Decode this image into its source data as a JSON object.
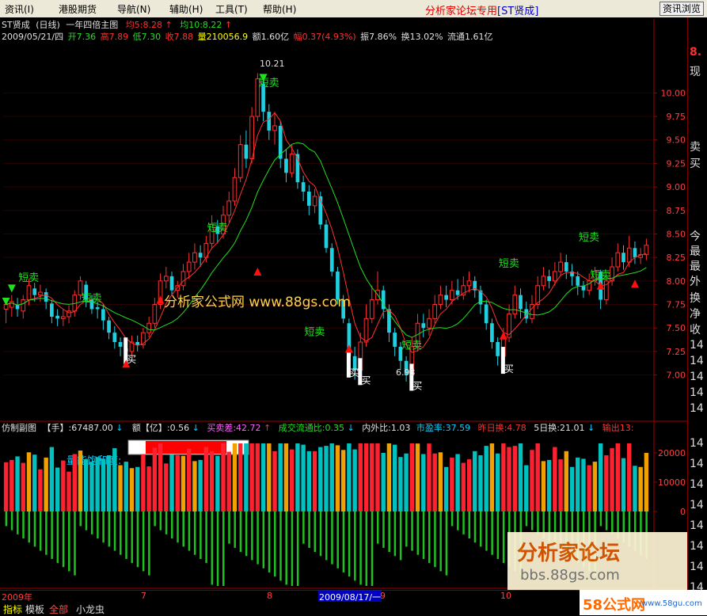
{
  "menubar": {
    "items": [
      "资讯(I)",
      "港股期货",
      "导航(N)",
      "辅助(H)",
      "工具(T)",
      "帮助(H)"
    ],
    "title": "分析家论坛专用",
    "title_stock": "[ST贤成]",
    "info_button": "资讯浏览"
  },
  "main_chart": {
    "header1": {
      "stock": "ST贤成",
      "period": "(日线)",
      "indicator": "一年四倍主图",
      "ma5_label": "均5:8.28",
      "ma10_label": "均10:8.22"
    },
    "header2": {
      "date": "2009/05/21/四",
      "open": "开7.36",
      "high": "高7.89",
      "low": "低7.30",
      "close": "收7.88",
      "volume": "量210056.9",
      "amount": "额1.60亿",
      "change": "幅0.37(4.93%)",
      "amplitude": "振7.86%",
      "turnover": "换13.02%",
      "float": "流通1.61亿"
    },
    "watermark": "分析家公式网 www.88gs.com",
    "peak_label": "10.21",
    "low_label": "6.93",
    "sell_label": "短卖",
    "buy_label": "买"
  },
  "chart_data": {
    "type": "candlestick",
    "y_axis": {
      "min": 6.55,
      "max": 10.5,
      "ticks": [
        "10.00",
        "9.75",
        "9.50",
        "9.25",
        "9.00",
        "8.75",
        "8.50",
        "8.25",
        "8.00",
        "7.75",
        "7.50",
        "7.25",
        "7.00"
      ]
    },
    "candles": [
      [
        7.7,
        7.75,
        7.55,
        7.82
      ],
      [
        7.72,
        7.78,
        7.62,
        7.85
      ],
      [
        7.75,
        7.7,
        7.62,
        7.82
      ],
      [
        7.68,
        7.8,
        7.6,
        7.85
      ],
      [
        7.8,
        7.95,
        7.74,
        8.02
      ],
      [
        7.92,
        7.85,
        7.78,
        7.98
      ],
      [
        7.85,
        7.88,
        7.78,
        7.96
      ],
      [
        7.88,
        7.78,
        7.7,
        7.92
      ],
      [
        7.76,
        7.62,
        7.55,
        7.8
      ],
      [
        7.63,
        7.6,
        7.52,
        7.7
      ],
      [
        7.6,
        7.62,
        7.52,
        7.7
      ],
      [
        7.62,
        7.68,
        7.55,
        7.74
      ],
      [
        7.68,
        7.85,
        7.62,
        7.9
      ],
      [
        7.85,
        8.0,
        7.8,
        8.05
      ],
      [
        7.96,
        7.8,
        7.72,
        8.0
      ],
      [
        7.8,
        7.7,
        7.65,
        7.85
      ],
      [
        7.72,
        7.7,
        7.6,
        7.78
      ],
      [
        7.7,
        7.58,
        7.48,
        7.75
      ],
      [
        7.58,
        7.45,
        7.38,
        7.62
      ],
      [
        7.45,
        7.35,
        7.28,
        7.52
      ],
      [
        7.35,
        7.3,
        7.2,
        7.4
      ],
      [
        7.28,
        7.25,
        7.18,
        7.35
      ],
      [
        7.25,
        7.35,
        7.2,
        7.42
      ],
      [
        7.35,
        7.32,
        7.25,
        7.42
      ],
      [
        7.32,
        7.45,
        7.28,
        7.5
      ],
      [
        7.45,
        7.55,
        7.4,
        7.62
      ],
      [
        7.55,
        7.75,
        7.5,
        7.82
      ],
      [
        7.75,
        8.0,
        7.7,
        8.08
      ],
      [
        8.0,
        8.05,
        7.92,
        8.15
      ],
      [
        8.05,
        7.9,
        7.85,
        8.1
      ],
      [
        7.9,
        7.95,
        7.82,
        8.0
      ],
      [
        7.95,
        8.1,
        7.9,
        8.18
      ],
      [
        8.1,
        8.2,
        8.02,
        8.3
      ],
      [
        8.2,
        8.3,
        8.12,
        8.4
      ],
      [
        8.3,
        8.25,
        8.15,
        8.38
      ],
      [
        8.25,
        8.4,
        8.2,
        8.48
      ],
      [
        8.4,
        8.6,
        8.35,
        8.7
      ],
      [
        8.58,
        8.5,
        8.4,
        8.65
      ],
      [
        8.5,
        8.7,
        8.45,
        8.8
      ],
      [
        8.7,
        8.85,
        8.62,
        8.95
      ],
      [
        8.85,
        9.1,
        8.8,
        9.2
      ],
      [
        9.1,
        9.45,
        9.05,
        9.55
      ],
      [
        9.45,
        9.3,
        9.2,
        9.6
      ],
      [
        9.3,
        9.75,
        9.25,
        9.85
      ],
      [
        9.75,
        10.15,
        9.7,
        10.21
      ],
      [
        10.1,
        9.8,
        9.7,
        10.15
      ],
      [
        9.8,
        9.6,
        9.5,
        9.88
      ],
      [
        9.6,
        9.65,
        9.45,
        9.8
      ],
      [
        9.65,
        9.3,
        9.2,
        9.7
      ],
      [
        9.3,
        9.15,
        9.05,
        9.4
      ],
      [
        9.15,
        9.35,
        9.1,
        9.45
      ],
      [
        9.35,
        9.05,
        8.98,
        9.4
      ],
      [
        9.05,
        8.95,
        8.85,
        9.12
      ],
      [
        8.95,
        8.8,
        8.7,
        9.02
      ],
      [
        8.8,
        8.9,
        8.72,
        8.98
      ],
      [
        8.9,
        8.6,
        8.55,
        8.95
      ],
      [
        8.6,
        8.35,
        8.3,
        8.65
      ],
      [
        8.35,
        8.1,
        8.05,
        8.4
      ],
      [
        8.1,
        7.8,
        7.75,
        8.15
      ],
      [
        7.8,
        7.6,
        7.55,
        7.85
      ],
      [
        7.55,
        7.2,
        7.1,
        7.6
      ],
      [
        7.2,
        7.05,
        6.95,
        7.3
      ],
      [
        7.05,
        7.35,
        7.0,
        7.45
      ],
      [
        7.35,
        7.6,
        7.3,
        7.75
      ],
      [
        7.6,
        7.8,
        7.55,
        7.95
      ],
      [
        7.8,
        7.9,
        7.75,
        8.1
      ],
      [
        7.9,
        7.7,
        7.6,
        7.95
      ],
      [
        7.7,
        7.45,
        7.35,
        7.75
      ],
      [
        7.45,
        7.3,
        7.2,
        7.5
      ],
      [
        7.3,
        7.15,
        7.05,
        7.35
      ],
      [
        7.15,
        7.0,
        6.93,
        7.2
      ],
      [
        7.0,
        7.3,
        6.95,
        7.4
      ],
      [
        7.3,
        7.55,
        7.25,
        7.65
      ],
      [
        7.55,
        7.5,
        7.4,
        7.65
      ],
      [
        7.5,
        7.6,
        7.42,
        7.7
      ],
      [
        7.6,
        7.75,
        7.55,
        7.85
      ],
      [
        7.75,
        7.85,
        7.7,
        7.95
      ],
      [
        7.85,
        7.8,
        7.72,
        7.95
      ],
      [
        7.8,
        7.9,
        7.75,
        8.0
      ],
      [
        7.9,
        7.85,
        7.8,
        8.02
      ],
      [
        7.85,
        7.95,
        7.8,
        8.05
      ],
      [
        7.95,
        8.0,
        7.88,
        8.1
      ],
      [
        8.0,
        7.9,
        7.82,
        8.05
      ],
      [
        7.9,
        7.75,
        7.65,
        7.95
      ],
      [
        7.75,
        7.55,
        7.48,
        7.8
      ],
      [
        7.55,
        7.35,
        7.28,
        7.6
      ],
      [
        7.35,
        7.2,
        7.1,
        7.4
      ],
      [
        7.2,
        7.4,
        7.15,
        7.5
      ],
      [
        7.4,
        7.65,
        7.35,
        7.75
      ],
      [
        7.65,
        7.85,
        7.6,
        7.95
      ],
      [
        7.85,
        7.7,
        7.6,
        7.92
      ],
      [
        7.7,
        7.6,
        7.55,
        7.78
      ],
      [
        7.6,
        7.75,
        7.55,
        7.85
      ],
      [
        7.75,
        7.95,
        7.7,
        8.05
      ],
      [
        7.95,
        8.05,
        7.9,
        8.15
      ],
      [
        8.05,
        8.0,
        7.92,
        8.12
      ],
      [
        8.0,
        8.1,
        7.95,
        8.2
      ],
      [
        8.1,
        8.2,
        8.05,
        8.3
      ],
      [
        8.2,
        8.1,
        8.02,
        8.28
      ],
      [
        8.1,
        8.05,
        7.95,
        8.18
      ],
      [
        8.05,
        7.95,
        7.85,
        8.1
      ],
      [
        7.95,
        7.9,
        7.82,
        8.0
      ],
      [
        7.9,
        8.0,
        7.85,
        8.08
      ],
      [
        8.0,
        8.1,
        7.95,
        8.15
      ],
      [
        8.1,
        7.8,
        7.7,
        8.12
      ],
      [
        7.8,
        8.0,
        7.75,
        8.05
      ],
      [
        8.0,
        8.15,
        7.95,
        8.25
      ],
      [
        8.15,
        8.3,
        8.1,
        8.4
      ],
      [
        8.3,
        8.2,
        8.12,
        8.38
      ],
      [
        8.2,
        8.35,
        8.15,
        8.48
      ],
      [
        8.35,
        8.25,
        8.18,
        8.42
      ],
      [
        8.25,
        8.28,
        8.18,
        8.35
      ],
      [
        8.28,
        8.38,
        8.22,
        8.45
      ]
    ],
    "ma_fast_color": "#ff3030",
    "ma_slow_color": "#20e020",
    "sell_marks": [
      [
        3,
        8.0
      ],
      [
        14,
        7.78
      ],
      [
        36,
        8.53
      ],
      [
        45,
        10.07
      ],
      [
        53,
        7.42
      ],
      [
        70,
        7.28
      ],
      [
        87,
        8.15
      ],
      [
        101,
        8.43
      ],
      [
        103,
        8.03
      ]
    ],
    "buy_marks": [
      [
        21,
        7.18
      ],
      [
        60,
        7.04
      ],
      [
        62,
        6.96
      ],
      [
        71,
        6.9
      ],
      [
        87,
        7.08
      ]
    ],
    "up_triangles": [
      [
        21,
        7.12
      ],
      [
        27,
        7.8
      ],
      [
        44,
        8.1
      ],
      [
        60,
        7.28
      ],
      [
        87,
        7.42
      ],
      [
        104,
        7.95
      ],
      [
        110,
        7.97
      ]
    ],
    "sub_chart": {
      "header": [
        "仿制副图",
        "【手】:67487.00",
        "额【亿】:0.56",
        "买卖差:42.72",
        "成交流通比:0.35",
        "内外比:1.03",
        "市盈率:37.59",
        "昨日换:4.78",
        "5日换:21.01",
        "输出13:"
      ],
      "saturation_label": "量能饱和度:",
      "saturation_value": 0.85,
      "y_ticks": [
        "20000",
        "10000",
        "0"
      ],
      "colors": {
        "up": "#ff2030",
        "down": "#00c0c0",
        "highlight": "#f0a000",
        "neg": "#20c020"
      }
    }
  },
  "time_axis": {
    "labels": [
      "2009年",
      "7",
      "8",
      "2009/08/17/一",
      "9",
      "10"
    ]
  },
  "right_panel": {
    "price": "8.",
    "items": [
      "现",
      "卖",
      "买",
      "今",
      "最",
      "最",
      "外",
      "换",
      "净",
      "收"
    ],
    "tail": [
      "14",
      "14",
      "14",
      "14",
      "14",
      "14",
      "14",
      "14",
      "14",
      "14",
      "14",
      "14",
      "14"
    ]
  },
  "tabs": [
    "指标",
    "模板",
    "全部",
    "小龙虫"
  ],
  "watermarks": {
    "forum_name": "分析家论坛",
    "forum_url": "bbs.88gs.com",
    "logo": "58公式网",
    "logo_url": "www.58gu.com"
  }
}
